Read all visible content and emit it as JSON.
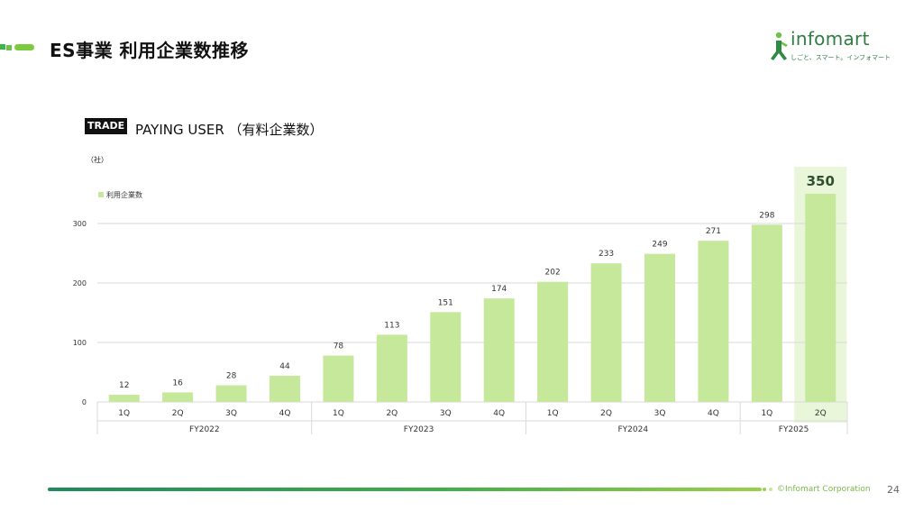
{
  "header": {
    "title": "ES事業 利用企業数推移"
  },
  "logo": {
    "name": "infomart",
    "tagline": "しごと、スマート。インフォマート"
  },
  "chart_heading": {
    "badge": "TRADE",
    "text": "PAYING USER （有料企業数）"
  },
  "unit_label": "（社）",
  "colors": {
    "bar": "#c6e89a",
    "highlight_bg": "#e9f6da",
    "grid": "#d9d9d9",
    "accent": "#3db54a"
  },
  "chart_data": {
    "type": "bar",
    "legend": "利用企業数",
    "legend_position": "top-left",
    "grid": true,
    "ylim": [
      0,
      350
    ],
    "yticks": [
      0,
      100,
      200,
      300
    ],
    "categories": [
      "1Q",
      "2Q",
      "3Q",
      "4Q",
      "1Q",
      "2Q",
      "3Q",
      "4Q",
      "1Q",
      "2Q",
      "3Q",
      "4Q",
      "1Q",
      "2Q"
    ],
    "groups": [
      {
        "label": "FY2022",
        "count": 4
      },
      {
        "label": "FY2023",
        "count": 4
      },
      {
        "label": "FY2024",
        "count": 4
      },
      {
        "label": "FY2025",
        "count": 2
      }
    ],
    "values": [
      12,
      16,
      28,
      44,
      78,
      113,
      151,
      174,
      202,
      233,
      249,
      271,
      298,
      350
    ],
    "highlight_index": 13
  },
  "footer": {
    "copyright": "©Infomart Corporation",
    "page": "24"
  }
}
